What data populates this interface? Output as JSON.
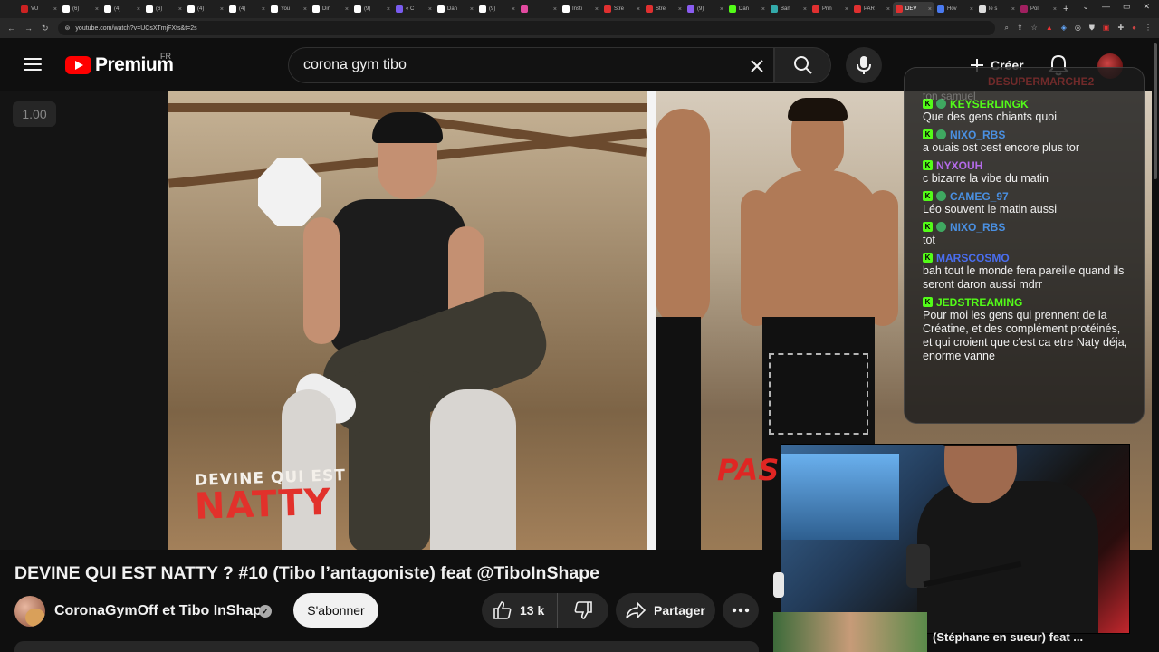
{
  "browser": {
    "tabs": [
      {
        "label": "VU",
        "color": "#c22"
      },
      {
        "label": "(6)",
        "color": "#fff"
      },
      {
        "label": "(4)",
        "color": "#fff"
      },
      {
        "label": "(6)",
        "color": "#fff"
      },
      {
        "label": "(4)",
        "color": "#fff"
      },
      {
        "label": "(4)",
        "color": "#fff"
      },
      {
        "label": "You",
        "color": "#fff"
      },
      {
        "label": "Din",
        "color": "#fff"
      },
      {
        "label": "(9)",
        "color": "#fff"
      },
      {
        "label": "« C",
        "color": "#7a5cf0"
      },
      {
        "label": "Dan",
        "color": "#fff"
      },
      {
        "label": "(9)",
        "color": "#fff"
      },
      {
        "label": "",
        "color": "#e24aa0"
      },
      {
        "label": "Insti",
        "color": "#fff"
      },
      {
        "label": "Stre",
        "color": "#e03030"
      },
      {
        "label": "Stre",
        "color": "#e03030"
      },
      {
        "label": "(9)",
        "color": "#8a5cf0"
      },
      {
        "label": "Dan",
        "color": "#53fc18"
      },
      {
        "label": "Ban",
        "color": "#3aa"
      },
      {
        "label": "Prin",
        "color": "#e03030"
      },
      {
        "label": "PAR",
        "color": "#e03030"
      },
      {
        "label": "DEV",
        "color": "#e03030",
        "active": true
      },
      {
        "label": "Hov",
        "color": "#4a7af0"
      },
      {
        "label": "le s",
        "color": "#ddd"
      },
      {
        "label": "Poli",
        "color": "#a02060"
      }
    ],
    "new_tab": "+",
    "url": "youtube.com/watch?v=UCsXTmjFXts&t=2s"
  },
  "masthead": {
    "logo_text": "Premium",
    "country": "FR",
    "search_value": "corona gym tibo",
    "create_label": "Créer"
  },
  "player": {
    "speed": "1.00",
    "overlay_line1": "DEVINE QUI EST",
    "overlay_line2": "NATTY",
    "overlay_right": "PAS"
  },
  "chat": {
    "prev_user": "DESUPERMARCHE2",
    "prev_text": "ton samuel",
    "messages": [
      {
        "user": "KEYSERLINGK",
        "color": "#53fc18",
        "sub": true,
        "text": "Que des gens chiants quoi"
      },
      {
        "user": "NIXO_RBS",
        "color": "#4a90e2",
        "sub": true,
        "text": "a ouais ost cest encore plus tor"
      },
      {
        "user": "NYXOUH",
        "color": "#b46ae8",
        "sub": false,
        "text": "c bizarre la vibe du matin"
      },
      {
        "user": "CAMEG_97",
        "color": "#4a90e2",
        "sub": true,
        "text": "Léo souvent le matin aussi"
      },
      {
        "user": "NIXO_RBS",
        "color": "#4a90e2",
        "sub": true,
        "text": "tot"
      },
      {
        "user": "MARSCOSMO",
        "color": "#4a6ef0",
        "sub": false,
        "text": "bah tout le monde fera pareille quand ils seront daron aussi mdrr"
      },
      {
        "user": "JEDSTREAMING",
        "color": "#53fc18",
        "sub": false,
        "text": "Pour moi les gens qui prennent de la Créatine, et des complément protéinés, et qui croient que c'est ca etre Naty déja, enorme vanne"
      }
    ]
  },
  "video": {
    "title": "DEVINE QUI EST NATTY ? #10 (Tibo l’antagoniste) feat @TiboInShape",
    "channel": "CoronaGymOff et Tibo InShape",
    "subscribe_label": "S'abonner",
    "likes": "13 k",
    "share_label": "Partager"
  },
  "sidebar": {
    "next_title": "(Stéphane en sueur) feat ..."
  }
}
